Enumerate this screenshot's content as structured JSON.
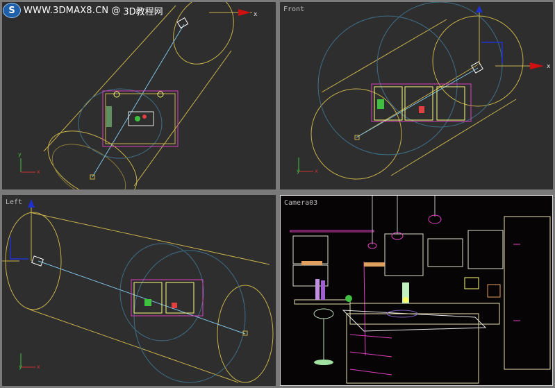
{
  "watermark": {
    "site": "WWW.3DMAX8.CN",
    "separator": "@",
    "name": "3D教程网"
  },
  "viewports": {
    "top": {
      "label": ""
    },
    "front": {
      "label": "Front"
    },
    "left": {
      "label": "Left"
    },
    "camera": {
      "label": "Camera03"
    }
  },
  "axes": {
    "x": "x",
    "y": "y"
  },
  "colors": {
    "viewport_bg": "#2e2e2e",
    "camera_bg": "#060404",
    "light_cone": "#c9b24a",
    "camera_line": "#7fc4e8",
    "wire_blue": "#3f6f8a",
    "magenta": "#e040c0",
    "gizmo_red": "#d01010",
    "gizmo_blue": "#2030d0"
  }
}
